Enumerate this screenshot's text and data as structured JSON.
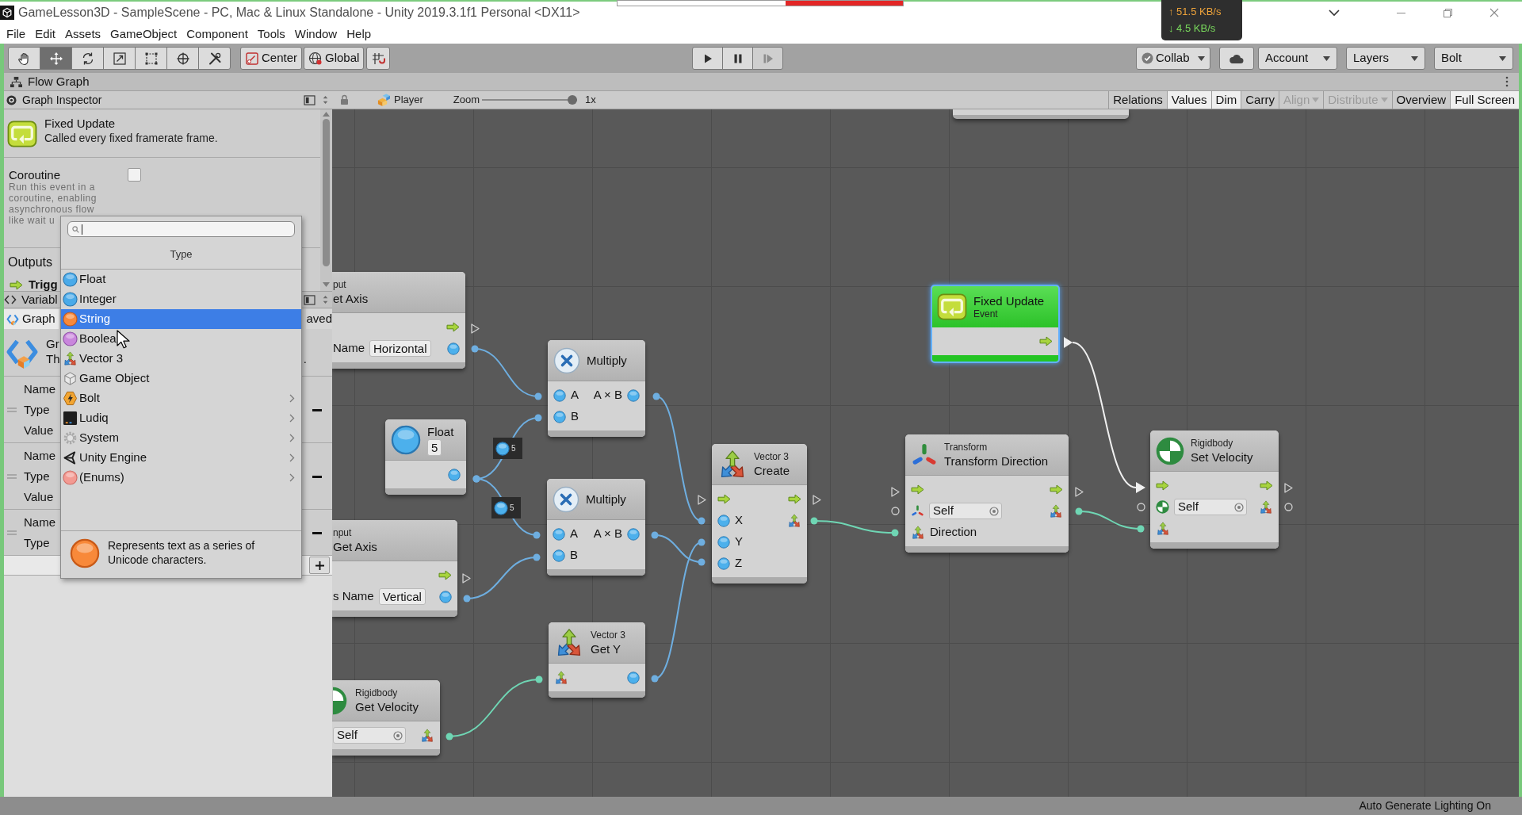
{
  "window": {
    "title": "GameLesson3D - SampleScene - PC, Mac & Linux Standalone - Unity 2019.3.1f1 Personal <DX11>"
  },
  "progress": {
    "level": 0.41
  },
  "net_speed": {
    "upload": "↑ 51.5 KB/s",
    "download": "↓ 4.5 KB/s"
  },
  "menu": [
    "File",
    "Edit",
    "Assets",
    "GameObject",
    "Component",
    "Tools",
    "Window",
    "Help"
  ],
  "toolbar": {
    "tools": [
      {
        "kind": "hand",
        "selected": false
      },
      {
        "kind": "move",
        "selected": true
      },
      {
        "kind": "rotate",
        "selected": false
      },
      {
        "kind": "scale",
        "selected": false
      },
      {
        "kind": "rect",
        "selected": false
      },
      {
        "kind": "transform",
        "selected": false
      },
      {
        "kind": "custom",
        "selected": false
      }
    ],
    "pivot": [
      {
        "kind": "center",
        "label": "Center"
      },
      {
        "kind": "global",
        "label": "Global"
      }
    ],
    "playback": [
      {
        "kind": "play",
        "disabled": false
      },
      {
        "kind": "pause",
        "disabled": false
      },
      {
        "kind": "step",
        "disabled": true
      }
    ],
    "right": [
      {
        "kind": "collab",
        "label": "Collab"
      },
      {
        "kind": "cloud"
      },
      {
        "kind": "dropdown",
        "label": "Account"
      },
      {
        "kind": "dropdown",
        "label": "Layers"
      },
      {
        "kind": "dropdown",
        "label": "Bolt"
      }
    ]
  },
  "window_tab": {
    "title": "Flow Graph"
  },
  "inspector": {
    "title": "Graph Inspector",
    "event": {
      "title": "Fixed Update",
      "description": "Called every fixed framerate frame."
    },
    "coroutine": {
      "label": "Coroutine",
      "checked": false,
      "description": "Run this event in a coroutine, enabling asynchronous flow",
      "description_cut": "like wait u"
    },
    "outputs": {
      "title": "Outputs",
      "items": [
        {
          "kind": "flow",
          "label": "Trigg"
        }
      ]
    }
  },
  "variables": {
    "title": "Variabl",
    "tabs": [
      {
        "kind": "graph",
        "label": "Graph",
        "selected": true
      },
      {
        "kind": "saved",
        "label": "aved",
        "selected": false
      }
    ],
    "graph": {
      "title": "Gr",
      "description": "Th",
      "description_end": "."
    },
    "items": [
      {
        "labels": [
          "Name",
          "Type",
          "Value"
        ]
      },
      {
        "labels": [
          "Name",
          "Type",
          "Value"
        ]
      },
      {
        "labels": [
          "Name",
          "Type"
        ]
      }
    ]
  },
  "type_menu": {
    "title": "Type",
    "items": [
      {
        "kind": "float",
        "label": "Float",
        "selected": false,
        "submenu": false
      },
      {
        "kind": "integer",
        "label": "Integer",
        "selected": false,
        "submenu": false
      },
      {
        "kind": "string",
        "label": "String",
        "selected": true,
        "submenu": false
      },
      {
        "kind": "boolean",
        "label": "Boolea",
        "selected": false,
        "submenu": false
      },
      {
        "kind": "vector3",
        "label": "Vector 3",
        "selected": false,
        "submenu": false
      },
      {
        "kind": "game_object",
        "label": "Game Object",
        "selected": false,
        "submenu": false
      },
      {
        "kind": "bolt",
        "label": "Bolt",
        "selected": false,
        "submenu": true
      },
      {
        "kind": "ludiq",
        "label": "Ludiq",
        "selected": false,
        "submenu": true
      },
      {
        "kind": "system",
        "label": "System",
        "selected": false,
        "submenu": true
      },
      {
        "kind": "unity_engine",
        "label": "Unity Engine",
        "selected": false,
        "submenu": true
      },
      {
        "kind": "enums",
        "label": "(Enums)",
        "selected": false,
        "submenu": true
      }
    ],
    "description": "Represents text as a series of Unicode characters."
  },
  "graph_toolbar": {
    "target": "Player",
    "zoom": {
      "label": "Zoom",
      "level": 1,
      "reading": "1x"
    },
    "buttons": [
      {
        "label": "Relations",
        "on": false,
        "disabled": false,
        "dropdown": false
      },
      {
        "label": "Values",
        "on": true,
        "disabled": false,
        "dropdown": false
      },
      {
        "label": "Dim",
        "on": true,
        "disabled": false,
        "dropdown": false
      },
      {
        "label": "Carry",
        "on": false,
        "disabled": false,
        "dropdown": false
      },
      {
        "label": "Align",
        "on": false,
        "disabled": true,
        "dropdown": true
      },
      {
        "label": "Distribute",
        "on": false,
        "disabled": true,
        "dropdown": true
      },
      {
        "label": "Overview",
        "on": false,
        "disabled": false,
        "dropdown": false
      },
      {
        "label": "Full Screen",
        "on": true,
        "disabled": false,
        "dropdown": false
      }
    ]
  },
  "graph": {
    "nodes": [
      {
        "kind": "get_axis",
        "subtitle": "put",
        "title": "et Axis",
        "selected": false,
        "rows": [
          {
            "kind": "flow_out"
          },
          {
            "kind": "value_out",
            "label": "Name",
            "field": {
              "kind": "text",
              "value": "Horizontal"
            }
          }
        ]
      },
      {
        "kind": "float_literal",
        "title": "Float",
        "field": {
          "kind": "text",
          "value": "5"
        },
        "selected": false,
        "rows": [
          {
            "kind": "value_out"
          }
        ]
      },
      {
        "kind": "multiply",
        "title": "Multiply",
        "selected": false,
        "rows": [
          {
            "kind": "value_in_out",
            "label": "A",
            "out_label": "A × B"
          },
          {
            "kind": "value_in",
            "label": "B"
          }
        ]
      },
      {
        "kind": "multiply",
        "title": "Multiply",
        "selected": false,
        "rows": [
          {
            "kind": "value_in_out",
            "label": "A",
            "out_label": "A × B"
          },
          {
            "kind": "value_in",
            "label": "B"
          }
        ]
      },
      {
        "kind": "vector3",
        "subtitle": "Vector 3",
        "title": "Create",
        "selected": false,
        "rows": [
          {
            "kind": "flow_through"
          },
          {
            "kind": "value_to_vector",
            "label": "X"
          },
          {
            "kind": "value_in",
            "label": "Y"
          },
          {
            "kind": "value_in",
            "label": "Z"
          }
        ]
      },
      {
        "kind": "vector3",
        "subtitle": "Vector 3",
        "title": "Get Y",
        "selected": false,
        "rows": [
          {
            "kind": "vector_to_value"
          }
        ]
      },
      {
        "kind": "get_axis",
        "subtitle": "nput",
        "title": "Get Axis",
        "selected": false,
        "rows": [
          {
            "kind": "flow_out"
          },
          {
            "kind": "value_out",
            "label": "s Name",
            "field": {
              "kind": "text",
              "value": "Vertical"
            }
          }
        ]
      },
      {
        "kind": "rigidbody",
        "subtitle": "Rigidbody",
        "title": "Get Velocity",
        "selected": false,
        "rows": [
          {
            "kind": "vector_out",
            "field": {
              "kind": "object",
              "value": "Self"
            }
          }
        ]
      },
      {
        "kind": "event",
        "title": "Fixed Update",
        "subtitle": "Event",
        "selected": true,
        "rows": [
          {
            "kind": "flow_out"
          }
        ]
      },
      {
        "kind": "transform",
        "subtitle": "Transform",
        "title": "Transform Direction",
        "selected": false,
        "rows": [
          {
            "kind": "flow_through"
          },
          {
            "kind": "transform_to_vector",
            "field": {
              "kind": "object",
              "value": "Self"
            }
          },
          {
            "kind": "vector_in",
            "label": "Direction"
          }
        ]
      },
      {
        "kind": "rigidbody",
        "subtitle": "Rigidbody",
        "title": "Set Velocity",
        "selected": false,
        "rows": [
          {
            "kind": "flow_through"
          },
          {
            "kind": "rigidbody_to_vector",
            "field": {
              "kind": "object",
              "value": "Self"
            }
          },
          {
            "kind": "vector_in"
          }
        ]
      }
    ],
    "connection_values": [
      "5",
      "5"
    ]
  },
  "status_bar": {
    "text": "Auto Generate Lighting On"
  }
}
